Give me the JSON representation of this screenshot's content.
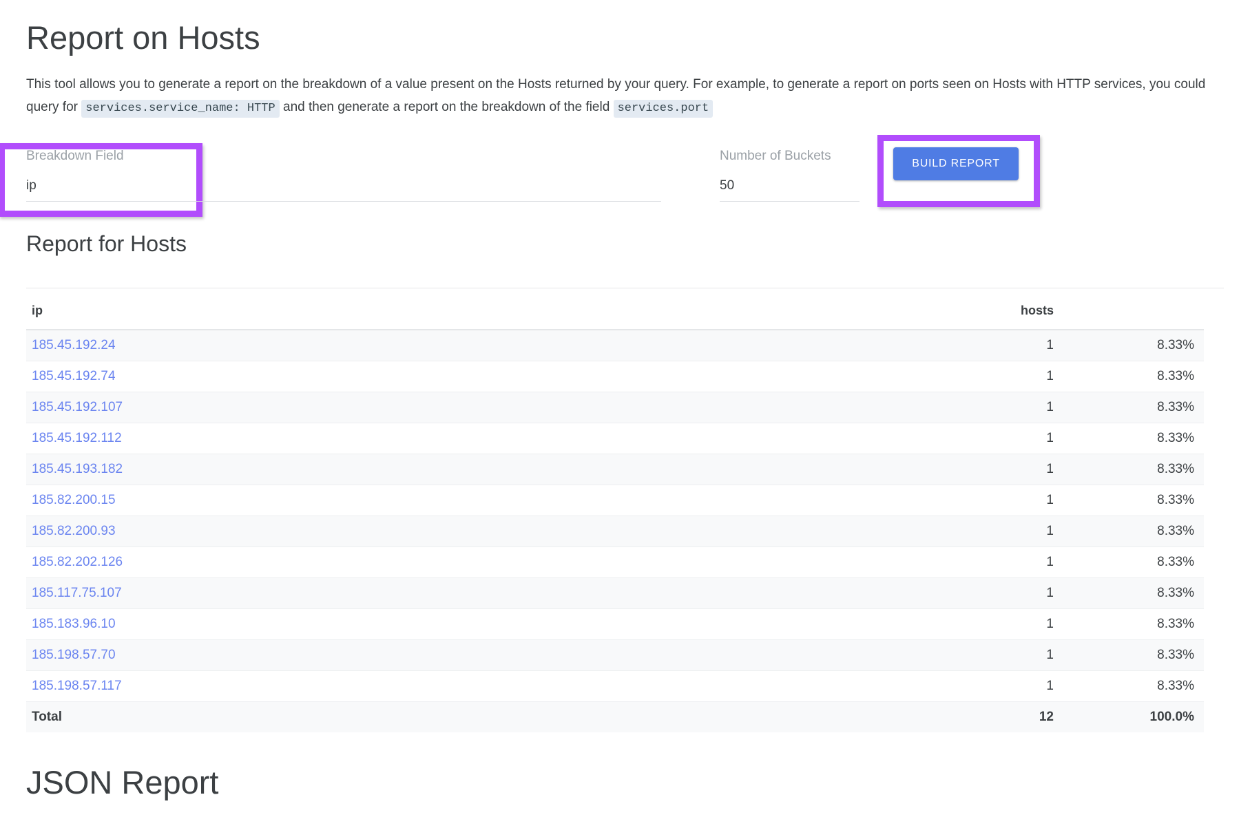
{
  "page": {
    "title": "Report on Hosts",
    "intro_part1": "This tool allows you to generate a report on the breakdown of a value present on the Hosts returned by your query. For example, to generate a report on ports seen on Hosts with HTTP services, you could query for ",
    "intro_code1": "services.service_name: HTTP",
    "intro_part2": " and then generate a report on the breakdown of the field ",
    "intro_code2": "services.port"
  },
  "form": {
    "breakdown_label": "Breakdown Field",
    "breakdown_value": "ip",
    "buckets_label": "Number of Buckets",
    "buckets_value": "50",
    "build_button_label": "BUILD REPORT",
    "highlight_color": "#b14dfc",
    "button_color": "#4f7ce4"
  },
  "report": {
    "section_title": "Report for Hosts",
    "columns": {
      "key": "ip",
      "count": "hosts",
      "pct": ""
    },
    "rows": [
      {
        "key": "185.45.192.24",
        "count": "1",
        "pct": "8.33%"
      },
      {
        "key": "185.45.192.74",
        "count": "1",
        "pct": "8.33%"
      },
      {
        "key": "185.45.192.107",
        "count": "1",
        "pct": "8.33%"
      },
      {
        "key": "185.45.192.112",
        "count": "1",
        "pct": "8.33%"
      },
      {
        "key": "185.45.193.182",
        "count": "1",
        "pct": "8.33%"
      },
      {
        "key": "185.82.200.15",
        "count": "1",
        "pct": "8.33%"
      },
      {
        "key": "185.82.200.93",
        "count": "1",
        "pct": "8.33%"
      },
      {
        "key": "185.82.202.126",
        "count": "1",
        "pct": "8.33%"
      },
      {
        "key": "185.117.75.107",
        "count": "1",
        "pct": "8.33%"
      },
      {
        "key": "185.183.96.10",
        "count": "1",
        "pct": "8.33%"
      },
      {
        "key": "185.198.57.70",
        "count": "1",
        "pct": "8.33%"
      },
      {
        "key": "185.198.57.117",
        "count": "1",
        "pct": "8.33%"
      }
    ],
    "total": {
      "key": "Total",
      "count": "12",
      "pct": "100.0%"
    }
  },
  "json_section": {
    "title": "JSON Report"
  }
}
